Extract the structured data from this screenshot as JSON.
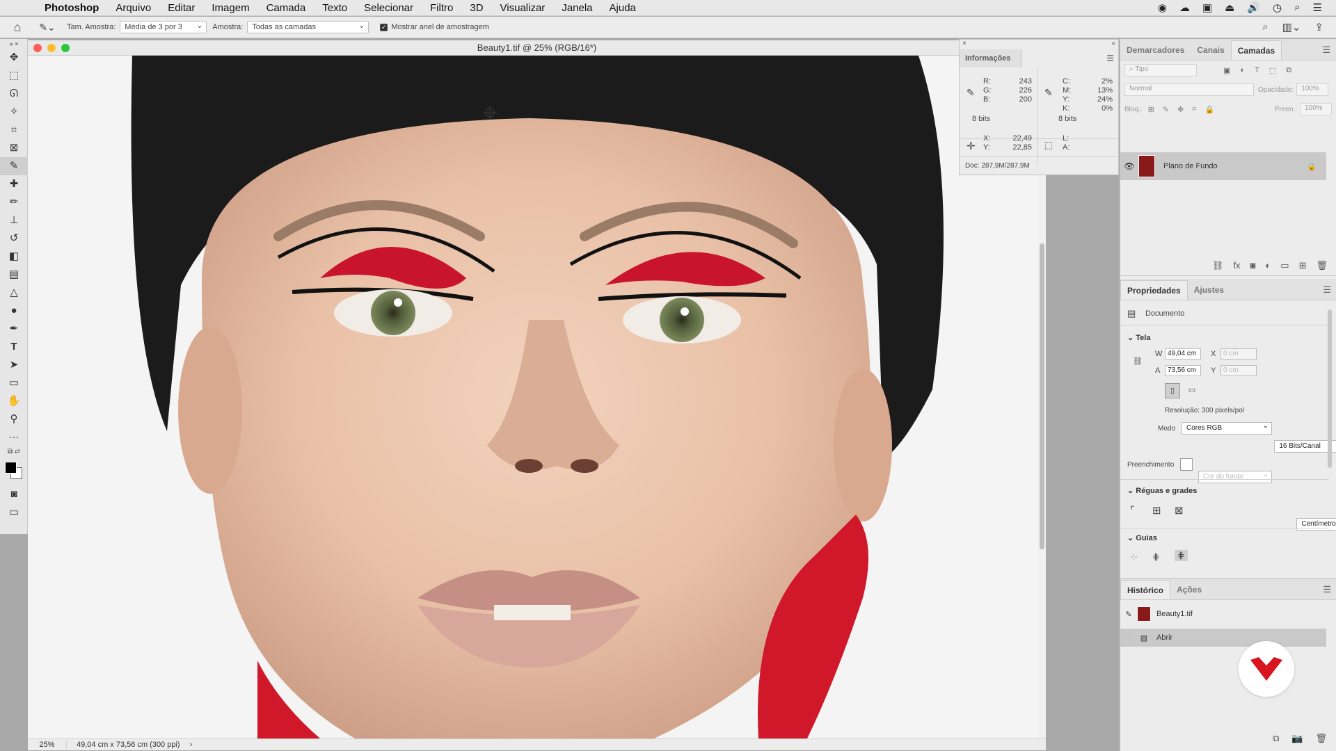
{
  "menubar": {
    "app": "Photoshop",
    "items": [
      "Arquivo",
      "Editar",
      "Imagem",
      "Camada",
      "Texto",
      "Selecionar",
      "Filtro",
      "3D",
      "Visualizar",
      "Janela",
      "Ajuda"
    ]
  },
  "options": {
    "sample_size_label": "Tam. Amostra:",
    "sample_size_value": "Média de 3 por 3",
    "sample_label": "Amostra:",
    "sample_value": "Todas as camadas",
    "ring_label": "Mostrar anel de amostragem"
  },
  "document": {
    "title": "Beauty1.tif @ 25% (RGB/16*)",
    "zoom": "25%",
    "dimensions": "49,04 cm x 73,56 cm (300 ppi)",
    "status_arrow": "›"
  },
  "info_panel": {
    "tab": "Informações",
    "r_label": "R:",
    "r": "243",
    "g_label": "G:",
    "g": "226",
    "b_label": "B:",
    "b": "200",
    "bits_left": "8 bits",
    "c_label": "C:",
    "c": "2%",
    "m_label": "M:",
    "m": "13%",
    "y_label": "Y:",
    "y": "24%",
    "k_label": "K:",
    "k": "0%",
    "bits_right": "8 bits",
    "x_label": "X:",
    "x": "22,49",
    "yc_label": "Y:",
    "yc": "22,85",
    "l_label": "L:",
    "a_label": "A:",
    "doc": "Doc: 287,9M/287,9M"
  },
  "layers_panel": {
    "tabs": [
      "Demarcadores",
      "Canais",
      "Camadas"
    ],
    "filter_placeholder": "Tipo",
    "blend": "Normal",
    "opacity_label": "Opacidade:",
    "opacity": "100%",
    "lock_label": "Bloq.:",
    "fill_label": "Preen.:",
    "fill": "100%",
    "layer_name": "Plano de Fundo"
  },
  "properties": {
    "tabs": [
      "Propriedades",
      "Ajustes"
    ],
    "doc_label": "Documento",
    "canvas_section": "Tela",
    "w_label": "W",
    "w": "49,04 cm",
    "x_label": "X",
    "x": "0 cm",
    "h_label": "A",
    "h": "73,56 cm",
    "y_label": "Y",
    "y": "0 cm",
    "resolution": "Resolução: 300 pixels/pol",
    "mode_label": "Modo",
    "mode": "Cores RGB",
    "bits": "16 Bits/Canal",
    "fill_label": "Preenchimento",
    "fill": "Cor do fundo",
    "rulers_section": "Réguas e grades",
    "units": "Centímetros",
    "guides_section": "Guias"
  },
  "history": {
    "tabs": [
      "Histórico",
      "Ações"
    ],
    "snapshot": "Beauty1.tif",
    "step": "Abrir"
  }
}
